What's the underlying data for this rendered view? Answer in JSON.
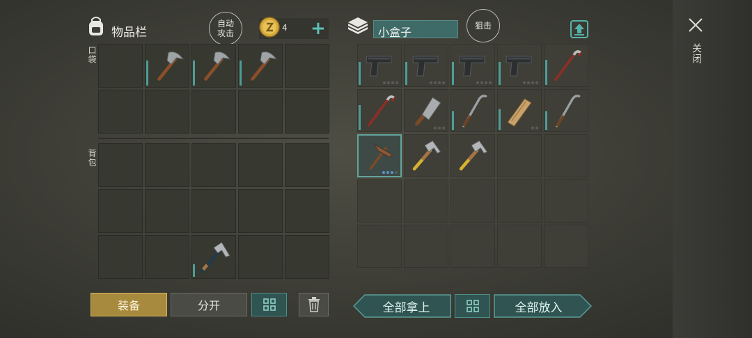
{
  "inventory": {
    "title": "物品栏",
    "pocket_label": "口袋",
    "backpack_label": "背包"
  },
  "auto_attack": {
    "label": "自动攻击"
  },
  "coins": {
    "count": "4"
  },
  "container": {
    "name": "小盒子",
    "snipe_label": "狙击"
  },
  "close": {
    "label": "关闭"
  },
  "bottom_left": {
    "equip": "装备",
    "split": "分开"
  },
  "bottom_right": {
    "take_all": "全部拿上",
    "put_all": "全部放入"
  },
  "colors": {
    "accent": "#4d9d98",
    "equip_gold": "#c9a34a",
    "selected": "#63a39c"
  },
  "pocket_items": [
    "",
    "pickaxe",
    "pickaxe",
    "pickaxe",
    "",
    "",
    "",
    "",
    "",
    ""
  ],
  "backpack_items": [
    "",
    "",
    "",
    "",
    "",
    "",
    "",
    "",
    "",
    "",
    "",
    "",
    "hammer",
    "",
    ""
  ],
  "container_items": [
    "pistol",
    "pistol",
    "pistol",
    "pistol",
    "crowbar",
    "crowbar",
    "cleaver",
    "hockey-stick",
    "wooden-plank",
    "hockey-stick",
    "crude-pickaxe",
    "hammer-yellow",
    "hammer-yellow",
    "",
    "",
    "",
    "",
    "",
    "",
    "",
    "",
    "",
    "",
    "",
    ""
  ]
}
